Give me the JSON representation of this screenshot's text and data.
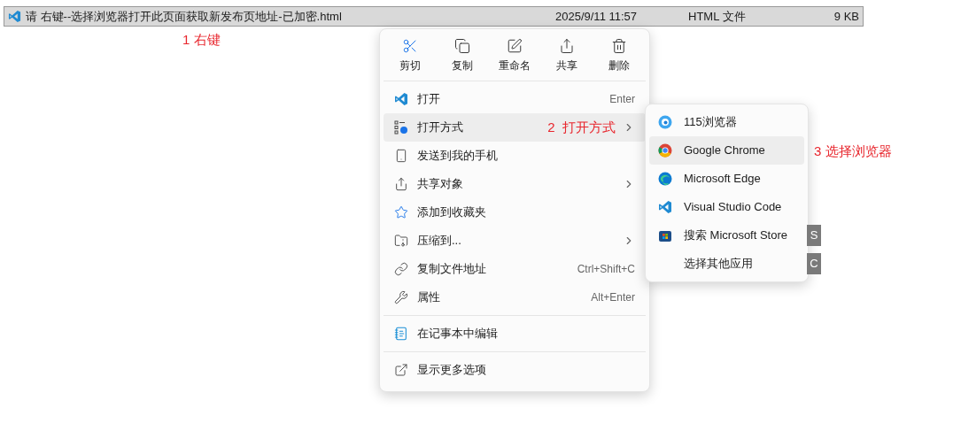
{
  "file_row": {
    "name": "请 右键--选择浏览器打开此页面获取新发布页地址-已加密.html",
    "modified": "2025/9/11 11:57",
    "type": "HTML 文件",
    "size": "9 KB",
    "selected": true
  },
  "annotations": [
    {
      "text": "1 右键"
    }
  ],
  "context_menu": {
    "toolbar": [
      {
        "label": "剪切"
      },
      {
        "label": "复制"
      },
      {
        "label": "重命名"
      },
      {
        "label": "共享"
      },
      {
        "label": "删除"
      }
    ],
    "sections": [
      [
        {
          "label": "打开",
          "shortcut": "Enter",
          "has_submenu": false,
          "selected": false
        },
        {
          "label": "打开方式",
          "annotation": "2  打开方式",
          "has_submenu": true,
          "selected": true
        },
        {
          "label": "发送到我的手机",
          "has_submenu": false,
          "selected": false
        },
        {
          "label": "共享对象",
          "has_submenu": true,
          "selected": false
        },
        {
          "label": "添加到收藏夹",
          "has_submenu": false,
          "selected": false
        },
        {
          "label": "压缩到...",
          "has_submenu": true,
          "selected": false
        },
        {
          "label": "复制文件地址",
          "shortcut": "Ctrl+Shift+C",
          "has_submenu": false,
          "selected": false
        },
        {
          "label": "属性",
          "shortcut": "Alt+Enter",
          "has_submenu": false,
          "selected": false
        }
      ],
      [
        {
          "label": "在记事本中编辑",
          "has_submenu": false,
          "selected": false
        }
      ],
      [
        {
          "label": "显示更多选项",
          "has_submenu": false,
          "selected": false
        }
      ]
    ]
  },
  "submenu": {
    "items": [
      {
        "label": "115浏览器",
        "selected": false
      },
      {
        "label": "Google Chrome",
        "selected": true,
        "annotation": "3 选择浏览器"
      },
      {
        "label": "Microsoft Edge",
        "selected": false
      },
      {
        "label": "Visual Studio Code",
        "selected": false
      },
      {
        "label": "搜索 Microsoft Store",
        "selected": false,
        "access_key": "S"
      },
      {
        "label": "选择其他应用",
        "selected": false,
        "access_key": "C"
      }
    ]
  }
}
